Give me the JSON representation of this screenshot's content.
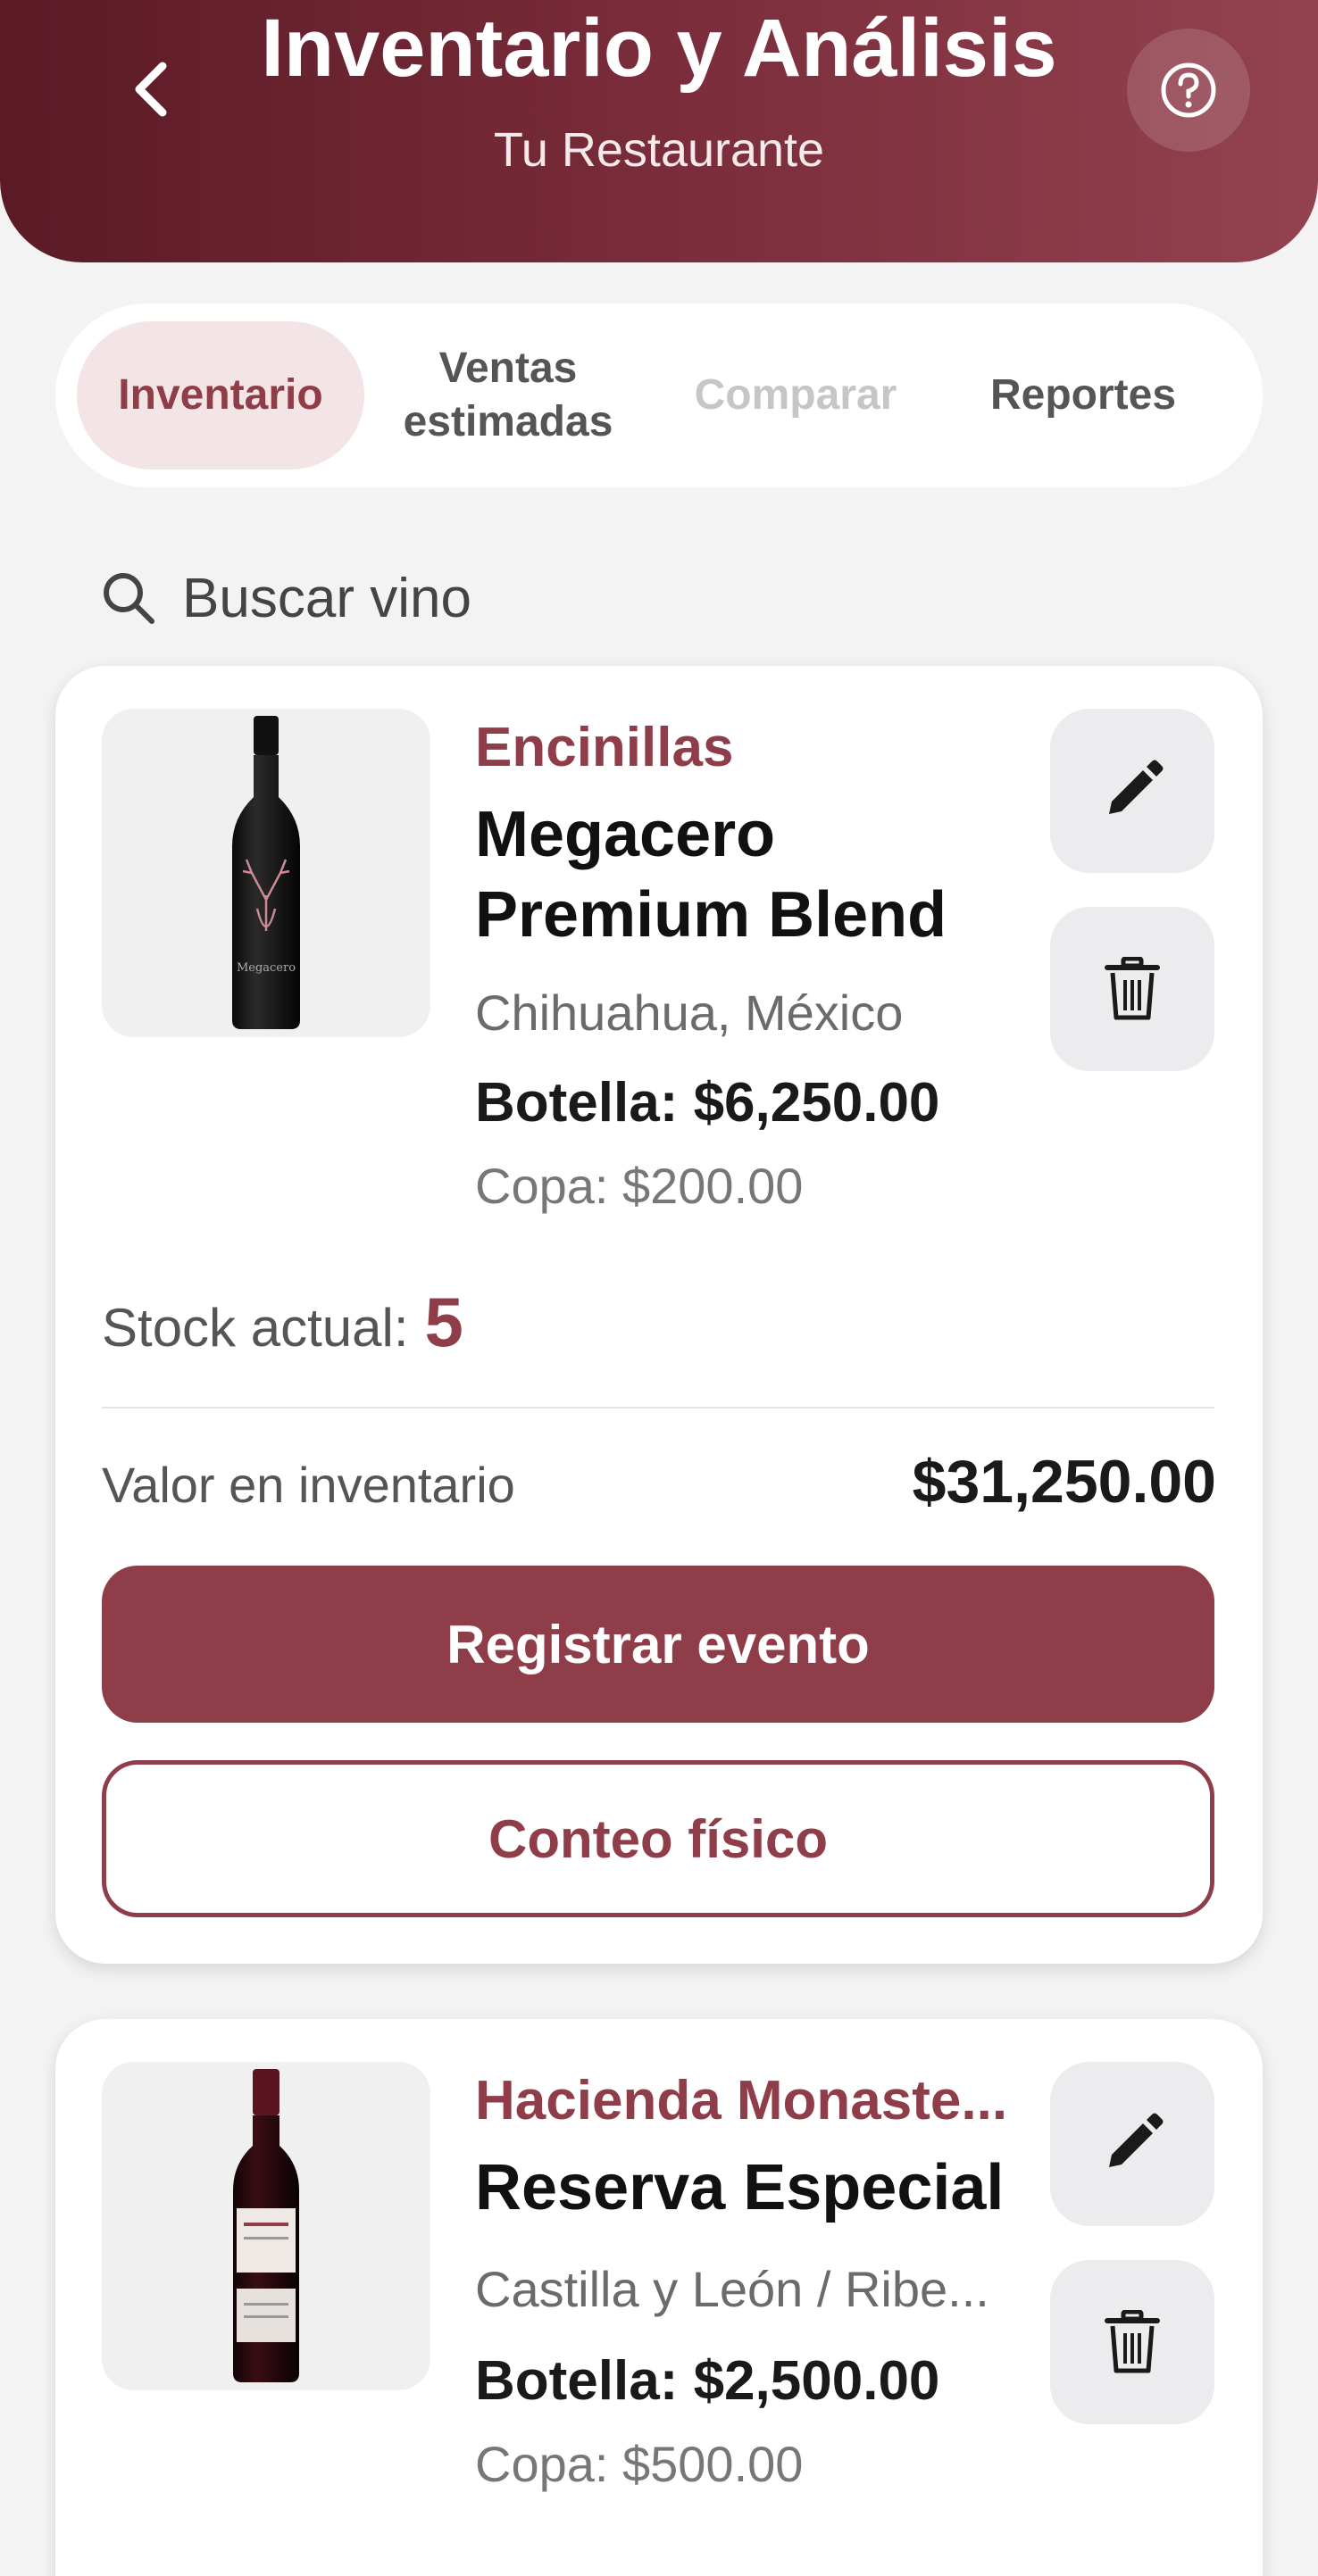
{
  "header": {
    "title": "Inventario y Análisis",
    "subtitle": "Tu Restaurante"
  },
  "tabs": [
    {
      "label": "Inventario",
      "state": "active"
    },
    {
      "label": "Ventas estimadas",
      "state": "normal"
    },
    {
      "label": "Comparar",
      "state": "disabled"
    },
    {
      "label": "Reportes",
      "state": "normal"
    }
  ],
  "search": {
    "placeholder": "Buscar vino"
  },
  "wines": [
    {
      "winery": "Encinillas",
      "name": "Megacero Premium Blend",
      "region": "Chihuahua, México",
      "bottle_price": "Botella: $6,250.00",
      "glass_price": "Copa: $200.00",
      "stock_label": "Stock actual:",
      "stock_value": "5",
      "inventory_label": "Valor en inventario",
      "inventory_value": "$31,250.00",
      "register_label": "Registrar evento",
      "count_label": "Conteo físico",
      "bottle_label_text": "Megacero"
    },
    {
      "winery": "Hacienda Monaste...",
      "name": "Reserva Especial",
      "region": "Castilla y León / Ribe...",
      "bottle_price": "Botella: $2,500.00",
      "glass_price": "Copa: $500.00"
    }
  ],
  "icons": {
    "back": "chevron-left-icon",
    "help": "question-circle-icon",
    "search": "search-icon",
    "edit": "pencil-icon",
    "delete": "trash-icon"
  },
  "colors": {
    "accent": "#8f3d48",
    "header_start": "#5a1a26",
    "header_end": "#93424f",
    "active_tab_bg": "#f3e4e6",
    "disabled_tab": "#c6c6c6",
    "icon_button_bg": "#ececee"
  }
}
